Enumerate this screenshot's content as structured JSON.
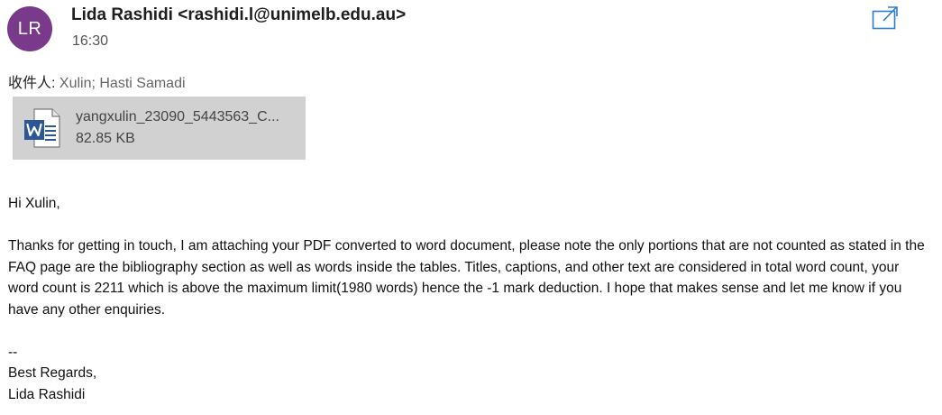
{
  "header": {
    "avatar_initials": "LR",
    "avatar_color": "#7a3a8c",
    "sender": "Lida Rashidi <rashidi.l@unimelb.edu.au>",
    "time": "16:30",
    "popout_icon": "popout-icon"
  },
  "recipients": {
    "label": "收件人:",
    "names": "Xulin; Hasti Samadi"
  },
  "attachment": {
    "icon": "word-document-icon",
    "filename": "yangxulin_23090_5443563_C...",
    "size": "82.85 KB"
  },
  "body": {
    "greeting": "Hi Xulin,",
    "paragraph": "Thanks for getting in touch, I am attaching your PDF converted to word document, please note the only portions that are not counted as stated in the FAQ page are the bibliography section as well as words inside the tables. Titles, captions, and other text are considered in total word count, your word count is 2211 which is above the maximum limit(1980 words) hence the -1 mark deduction. I hope that makes sense and let me know if you have any other enquiries.",
    "signature_separator": "--",
    "signoff": "Best Regards,",
    "signature_name": "Lida Rashidi"
  }
}
